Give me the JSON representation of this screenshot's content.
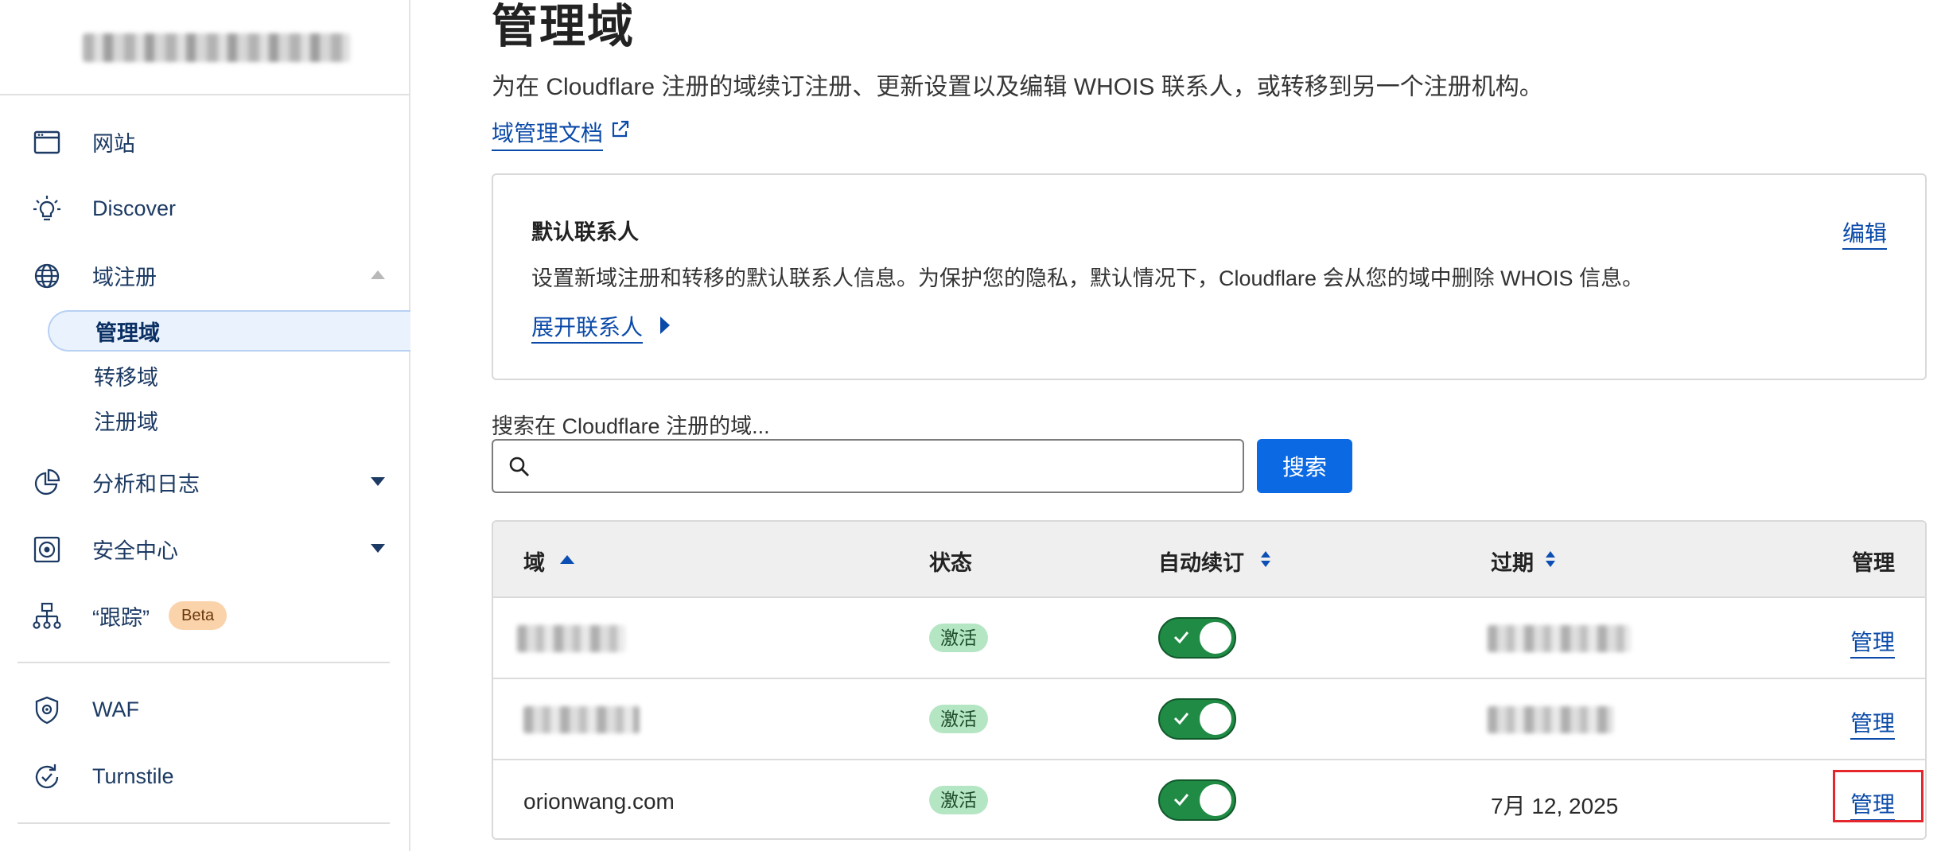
{
  "sidebar": {
    "items": [
      {
        "label": "网站",
        "icon": "browser-window-icon"
      },
      {
        "label": "Discover",
        "icon": "lightbulb-icon"
      },
      {
        "label": "域注册",
        "icon": "globe-icon"
      },
      {
        "label": "分析和日志",
        "icon": "pie-chart-icon"
      },
      {
        "label": "安全中心",
        "icon": "security-center-icon"
      },
      {
        "label": "“跟踪”",
        "icon": "sitemap-icon",
        "badge": "Beta"
      },
      {
        "label": "WAF",
        "icon": "shield-gear-icon"
      },
      {
        "label": "Turnstile",
        "icon": "turnstile-icon"
      }
    ],
    "domain_registration_sub": [
      {
        "label": "管理域",
        "active": true
      },
      {
        "label": "转移域"
      },
      {
        "label": "注册域"
      }
    ]
  },
  "header": {
    "title": "管理域",
    "description": "为在 Cloudflare 注册的域续订注册、更新设置以及编辑 WHOIS 联系人，或转移到另一个注册机构。",
    "doc_link": "域管理文档"
  },
  "contact_card": {
    "title": "默认联系人",
    "description": "设置新域注册和转移的默认联系人信息。为保护您的隐私，默认情况下，Cloudflare 会从您的域中删除 WHOIS 信息。",
    "expand_label": "展开联系人",
    "edit_label": "编辑"
  },
  "search": {
    "label": "搜索在 Cloudflare 注册的域...",
    "placeholder": "",
    "button": "搜索"
  },
  "table": {
    "headers": {
      "domain": "域",
      "status": "状态",
      "auto_renew": "自动续订",
      "expiry": "过期",
      "manage": "管理"
    },
    "rows": [
      {
        "domain": "",
        "status": "激活",
        "auto_renew": true,
        "expiry": "",
        "manage": "管理"
      },
      {
        "domain": "",
        "status": "激活",
        "auto_renew": true,
        "expiry": "",
        "manage": "管理"
      },
      {
        "domain": "orionwang.com",
        "status": "激活",
        "auto_renew": true,
        "expiry": "7月 12, 2025",
        "manage": "管理"
      }
    ]
  },
  "colors": {
    "accent_blue": "#0b69e3",
    "link_blue": "#0a4aa8",
    "toggle_green": "#1f8b45",
    "badge_green": "#b4e6c3",
    "beta_orange": "#fbd3ab",
    "highlight_red": "#e5262c"
  }
}
